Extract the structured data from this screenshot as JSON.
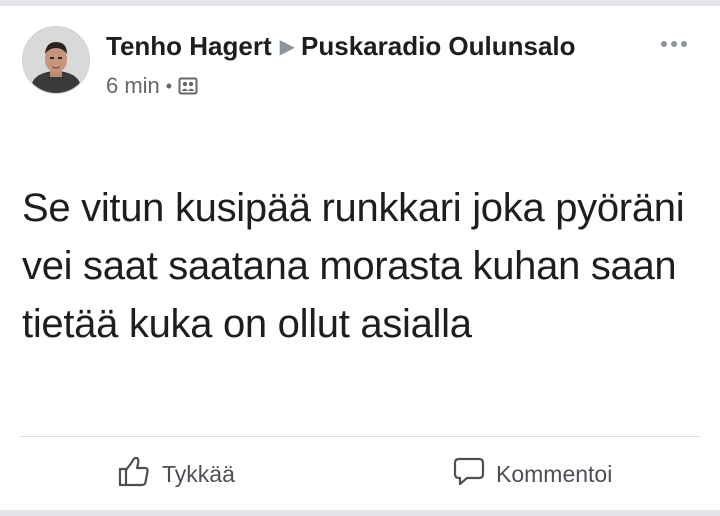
{
  "post": {
    "author": "Tenho Hagert",
    "group": "Puskaradio Oulunsalo",
    "timestamp": "6 min",
    "separator": "•",
    "arrow": "▶",
    "audience_icon": "group-audience-icon",
    "more_icon": "more-dots-icon",
    "text": "Se vitun kusipää runkkari joka pyöräni vei saat saatana morasta kuhan saan tietää kuka on ollut asialla"
  },
  "actions": {
    "like_label": "Tykkää",
    "like_icon": "thumbs-up-icon",
    "comment_label": "Kommentoi",
    "comment_icon": "comment-bubble-icon"
  },
  "colors": {
    "text_primary": "#1c1e21",
    "text_secondary": "#65676b",
    "icon_gray": "#8d949e",
    "background_strip": "#e4e5e8",
    "divider": "#dadde1"
  }
}
